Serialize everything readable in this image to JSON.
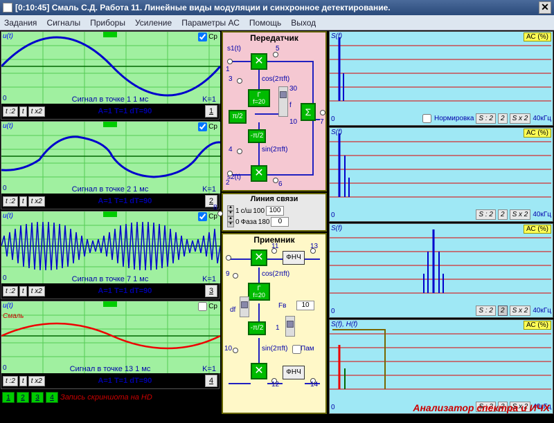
{
  "title": "[0:10:45] Смаль С.Д.  Работа 11. Линейные виды модуляции и синхронное детектирование.",
  "menu": [
    "Задания",
    "Сигналы",
    "Приборы",
    "Усиление",
    "Параметры АС",
    "Помощь",
    "Выход"
  ],
  "scopes": [
    {
      "ylabel": "u(t)",
      "cp": "Ср",
      "caption": "Сигнал в точке 1     1 мс",
      "k": "K=1",
      "buttons": [
        "t :2",
        "t",
        "t x2"
      ],
      "params": "A=1      T=1      dT=90",
      "num": "1"
    },
    {
      "ylabel": "u(t)",
      "cp": "Ср",
      "caption": "Сигнал в точке 2     1 мс",
      "k": "K=1",
      "buttons": [
        "t :2",
        "t",
        "t x2"
      ],
      "params": "A=1      T=1      dT=90",
      "num": "2"
    },
    {
      "ylabel": "u(t)",
      "cp": "Ср",
      "caption": "Сигнал в точке 7     1 мс",
      "k": "K=1",
      "buttons": [
        "t :2",
        "t",
        "t x2"
      ],
      "params": "A=1      T=1      dT=90",
      "num": "3"
    },
    {
      "ylabel": "u(t)",
      "cp": "Ср",
      "caption": "Сигнал в точке 13     1 мс",
      "k": "K=1",
      "buttons": [
        "t :2",
        "t",
        "t x2"
      ],
      "params": "A=1      T=1      dT=90",
      "num": "4",
      "extra": "Смаль"
    }
  ],
  "tx": {
    "title": "Передатчик",
    "s1": "s1(t)",
    "s2": "s2(t)",
    "n1": "1",
    "n3": "3",
    "n4": "4",
    "n2": "2",
    "n5": "5",
    "n6": "6",
    "n7": "7",
    "cos": "cos(2πft)",
    "sin": "sin(2πft)",
    "f": "f",
    "pi2a": "π/2",
    "pi2b": "-π/2",
    "gen": "Г\nf=20",
    "sum": "Σ",
    "v30": "30",
    "v10": "10"
  },
  "line": {
    "title": "Линия связи",
    "n8": "8",
    "col1": "1",
    "csh": "с/ш",
    "v100": "100",
    "phase": "Фаза",
    "v180": "180",
    "v0": "0",
    "valbox": "100"
  },
  "rx": {
    "title": "Приемник",
    "n9": "9",
    "n10": "10",
    "n11": "11",
    "n12": "12",
    "n13": "13",
    "n14": "14",
    "cos": "cos(2πft)",
    "sin": "sin(2πft)",
    "fnc": "ФНЧ",
    "gen": "Г\nf=20",
    "pi2": "-π/2",
    "df": "df",
    "fv": "Fв",
    "v10": "10",
    "v1": "1",
    "pam": "Пам"
  },
  "spectra": [
    {
      "ylabel": "S(f)",
      "ac": "АС (%)",
      "norm": "Нормировка",
      "btns": [
        "S : 2",
        "2",
        "S x 2"
      ],
      "khz": "40кГц",
      "normbox": true
    },
    {
      "ylabel": "S(f)",
      "ac": "АС (%)",
      "btns": [
        "S : 2",
        "2",
        "S x 2"
      ],
      "khz": "40кГц"
    },
    {
      "ylabel": "S(f)",
      "ac": "АС (%)",
      "btns": [
        "S : 2",
        "2",
        "S x 2"
      ],
      "khz": "40кГц",
      "sel": 1
    },
    {
      "ylabel": "S(f), H(f)",
      "ac": "АС (%)",
      "btns": [
        "S : 2",
        "2",
        "S x 2"
      ],
      "khz": "40кГц",
      "analyzer": "Анализатор спектра и ИЧХ"
    }
  ],
  "footer": {
    "btns": [
      "1",
      "2",
      "3",
      "4"
    ],
    "text": "Запись скриншота на HD"
  },
  "zero": "0"
}
